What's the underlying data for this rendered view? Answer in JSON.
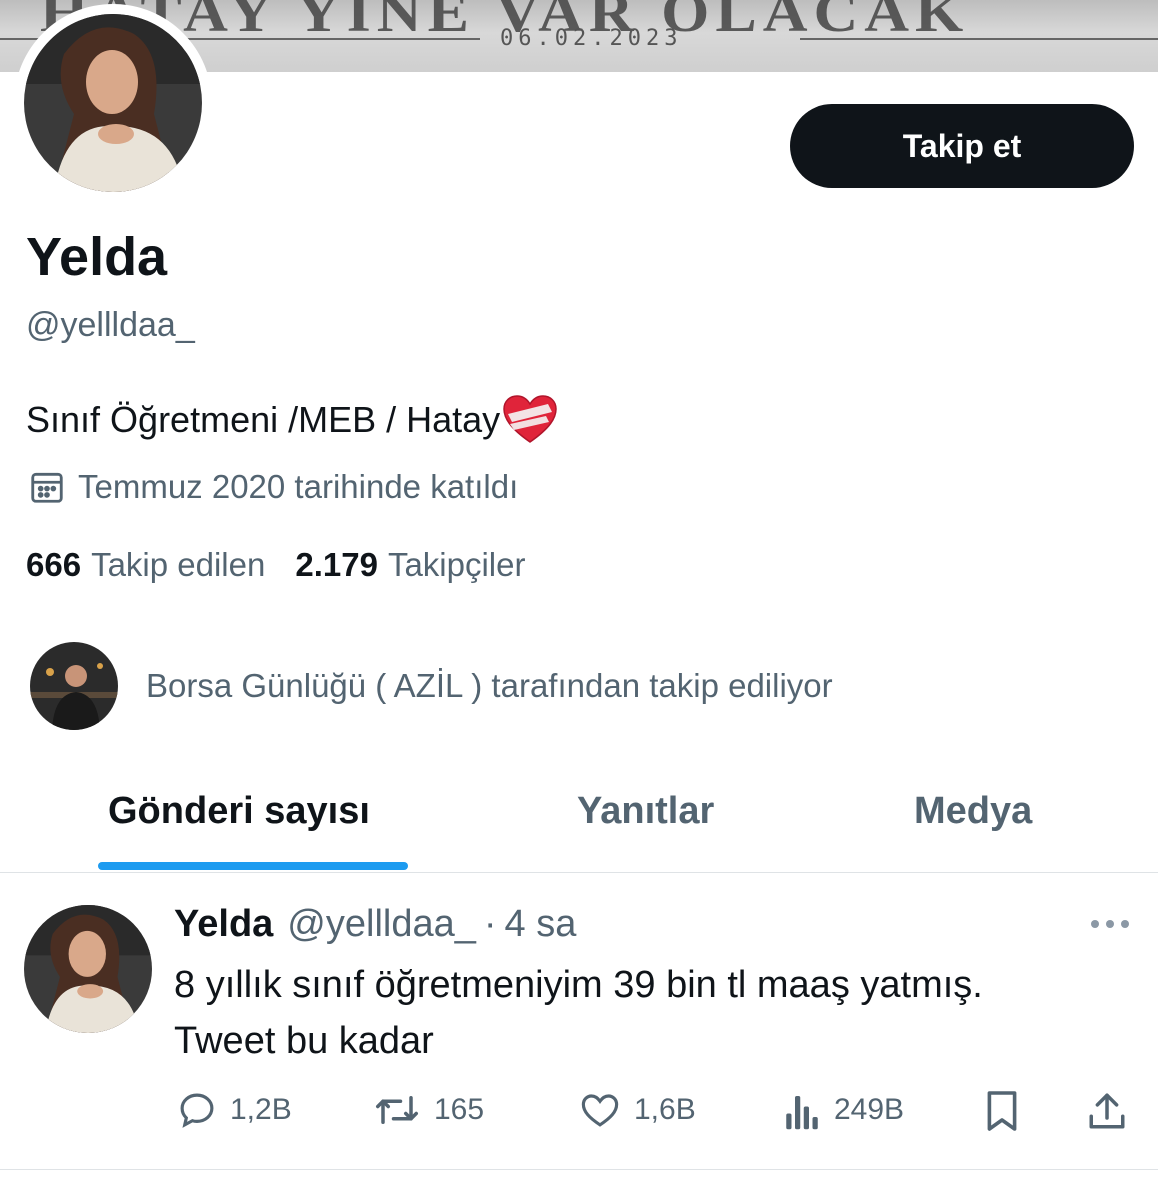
{
  "banner": {
    "headline": "HATAY YİNE VAR OLACAK",
    "date": "06.02.2023"
  },
  "profile": {
    "name": "Yelda",
    "handle": "@yellldaa_",
    "bio": "Sınıf Öğretmeni /MEB / Hatay",
    "joined": "Temmuz 2020 tarihinde katıldı",
    "following_count": "666",
    "following_label": "Takip edilen",
    "followers_count": "2.179",
    "followers_label": "Takipçiler",
    "followed_by": "Borsa Günlüğü ( AZİL ) tarafından takip ediliyor"
  },
  "follow_button": "Takip et",
  "tabs": [
    {
      "label": "Gönderi sayısı",
      "active": true
    },
    {
      "label": "Yanıtlar",
      "active": false
    },
    {
      "label": "Medya",
      "active": false
    }
  ],
  "tweet": {
    "name": "Yelda",
    "handle": "@yellldaa_",
    "dot": "·",
    "time": "4 sa",
    "text_line1": "8 yıllık sınıf öğretmeniyim 39 bin tl maaş yatmış.",
    "text_line2": "Tweet bu kadar",
    "replies": "1,2B",
    "retweets": "165",
    "likes": "1,6B",
    "views": "249B"
  },
  "colors": {
    "text": "#0f1419",
    "secondary": "#536471",
    "accent": "#1d9bf0"
  },
  "icons": [
    "calendar-icon",
    "heart-emoji-icon",
    "more-icon",
    "reply-icon",
    "retweet-icon",
    "like-icon",
    "views-icon",
    "bookmark-icon",
    "share-icon"
  ]
}
